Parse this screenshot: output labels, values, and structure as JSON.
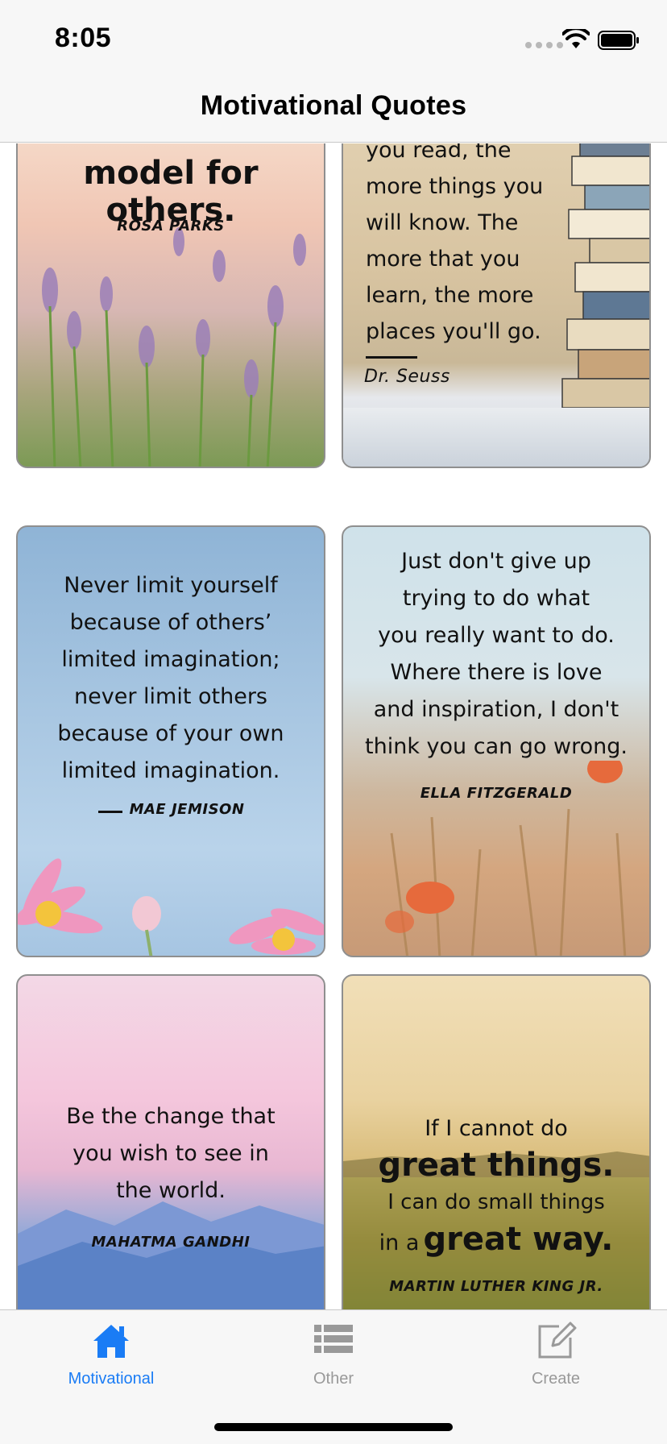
{
  "status_bar": {
    "time": "8:05"
  },
  "nav": {
    "title": "Motivational Quotes"
  },
  "cards": [
    {
      "lines": [
        "model for others."
      ],
      "author": "ROSA PARKS"
    },
    {
      "lines": [
        "you read, the",
        "more things you",
        "will know. The",
        "more that you",
        "learn, the more",
        "places you'll go."
      ],
      "author": "Dr. Seuss"
    },
    {
      "lines": [
        "Never limit yourself",
        "because of others’",
        "limited imagination;",
        "never limit others",
        "because of your own",
        "limited imagination."
      ],
      "author": "MAE JEMISON"
    },
    {
      "lines": [
        "Just don't give up",
        "trying to do what",
        "you really want to do.",
        "Where there is love",
        "and inspiration, I don't",
        "think you can go wrong."
      ],
      "author": "ELLA FITZGERALD"
    },
    {
      "lines": [
        "Be the change that",
        "you wish to see in",
        "the world."
      ],
      "author": "MAHATMA GANDHI"
    },
    {
      "lines": [
        "If I cannot do",
        "great things.",
        "I can do small things",
        "in a",
        "great way."
      ],
      "author": "MARTIN LUTHER KING JR."
    }
  ],
  "tabs": [
    {
      "label": "Motivational",
      "icon": "house-icon",
      "active": true
    },
    {
      "label": "Other",
      "icon": "list-icon",
      "active": false
    },
    {
      "label": "Create",
      "icon": "compose-icon",
      "active": false
    }
  ],
  "colors": {
    "accent": "#1a7cf5",
    "inactive": "#999999"
  }
}
